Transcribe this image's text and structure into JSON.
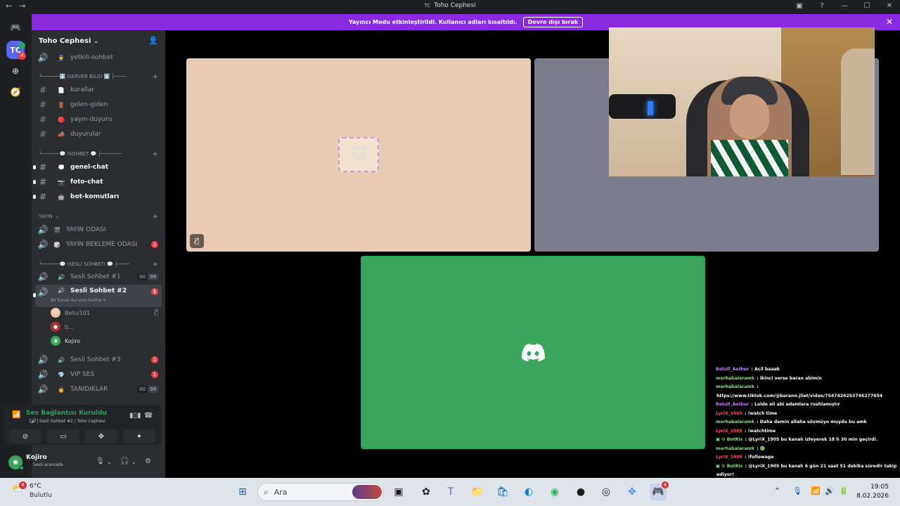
{
  "window": {
    "title": "Toho Cephesi",
    "title_mark": "TC"
  },
  "banner": {
    "message": "Yayıncı Modu etkinleştirildi. Kullanıcı adları kısaltıldı.",
    "button": "Devre dışı bırak"
  },
  "rail": {
    "server_initials": "TC",
    "unread_badge": "4"
  },
  "server": {
    "name": "Toho Cephesi"
  },
  "categories": {
    "server_info": "└──────⬇️ ISERVER BİLGİ ⬇️ ├────",
    "chat": "└──────💬 ISOHBET 💬 ├───────",
    "stream": "YAYIN",
    "voice": "└──────💬 ISESLİ SOHBETI 💬 ├────"
  },
  "channels": {
    "yetkili": {
      "emoji": "👮",
      "name": "yetkili-sohbet"
    },
    "kurallar": {
      "emoji": "📄",
      "name": "kurallar"
    },
    "gelen": {
      "emoji": "🚪",
      "name": "gelen-giden"
    },
    "yayin_duyuru": {
      "emoji": "🔴",
      "name": "yayın-duyuru"
    },
    "duyurular": {
      "emoji": "📣",
      "name": "duyurular"
    },
    "genel": {
      "emoji": "💭",
      "name": "genel-chat"
    },
    "foto": {
      "emoji": "📷",
      "name": "foto-chat"
    },
    "bot": {
      "emoji": "🤖",
      "name": "bot-komutları"
    },
    "yayin_odasi": {
      "emoji": "🎬",
      "name": "YAYIN ODASI",
      "count": ""
    },
    "yayin_bekleme": {
      "emoji": "🎲",
      "name": "YAYIN BEKLEME ODASI",
      "count": "1"
    },
    "sesli1": {
      "emoji": "🔊",
      "name": "Sesli Sohbet #1",
      "pill_a": "00",
      "pill_b": "99"
    },
    "sesli2": {
      "emoji": "🔊",
      "name": "Sesli Sohbet #2",
      "count": "1",
      "status_hint": "Bir kanal durumu belirle ✎"
    },
    "sesli3": {
      "emoji": "🔊",
      "name": "Sesli Sohbet #3",
      "count": "1"
    },
    "vip": {
      "emoji": "💎",
      "name": "VIP SES",
      "count": "1"
    },
    "tanidiklar": {
      "emoji": "👩",
      "name": "TANIDIKLAR",
      "pill_a": "00",
      "pill_b": "99"
    }
  },
  "voice_users": [
    {
      "name": "Betul101"
    },
    {
      "name": "b..."
    },
    {
      "name": "Kojiro"
    }
  ],
  "voice_panel": {
    "status": "Ses Bağlantısı Kuruldu",
    "location": "[🔊] Sesli Sohbet #2 / Toho Cephesi"
  },
  "user": {
    "name": "Kojiro",
    "status": "Sesli aramada"
  },
  "chat": [
    {
      "user": "Betull_Aether",
      "color": "#c77dff",
      "text": " : Acil baaak"
    },
    {
      "user": "merhabalaramk",
      "color": "#7fe57f",
      "text": " : ikinci verse baran abimin"
    },
    {
      "user": "merhabalaramk",
      "color": "#7fe57f",
      "text": " :"
    },
    {
      "user": "",
      "color": "#ffffff",
      "text": "https://www.tiktok.com/@barann.jliet/video/7547426253746277654"
    },
    {
      "user": "Betull_Aether",
      "color": "#c77dff",
      "text": " : Lolde ali abi adamlara rushlamıştır"
    },
    {
      "user": "LyriX_1905",
      "color": "#ff4d6d",
      "text": " : !watch time"
    },
    {
      "user": "merhabalaramk",
      "color": "#7fe57f",
      "text": " : Daha demin allaha sövmüyo muydu bu amk"
    },
    {
      "user": "LyriX_1905",
      "color": "#ff4d6d",
      "text": " : !watchtime"
    },
    {
      "user": "▣ ⚙ BotRix",
      "color": "#7fe57f",
      "text": " : @LyriX_1905 bu kanalı izleyerek 18 h 30 min geçirdi."
    },
    {
      "user": "merhabalaramk",
      "color": "#7fe57f",
      "text": " : 🟢"
    },
    {
      "user": "LyriX_1905",
      "color": "#ff4d6d",
      "text": " : !followage"
    },
    {
      "user": "▣ ⚙ BotRix",
      "color": "#7fe57f",
      "text": " : @LyriX_1905 bu kanalı 6 gün 21 saat 51 dakika süredir takip"
    },
    {
      "user": "",
      "color": "#ffffff",
      "text": "ediyor!"
    }
  ],
  "taskbar": {
    "weather_badge": "4",
    "temperature": "6°C",
    "weather": "Bulutlu",
    "search_placeholder": "Ara",
    "discord_badge": "4",
    "time": "19:05",
    "date": "8.02.2026"
  },
  "icons": {
    "back": "back-arrow-icon",
    "forward": "forward-arrow-icon",
    "text_channel": "hash-icon",
    "voice_channel": "speaker-icon",
    "mute": "muted-mic-icon"
  },
  "colors": {
    "accent": "#5865f2",
    "banner": "#8a2be2",
    "connected": "#23a55a",
    "speaking_tile": "#3ba55d",
    "notification": "#f23f43"
  }
}
